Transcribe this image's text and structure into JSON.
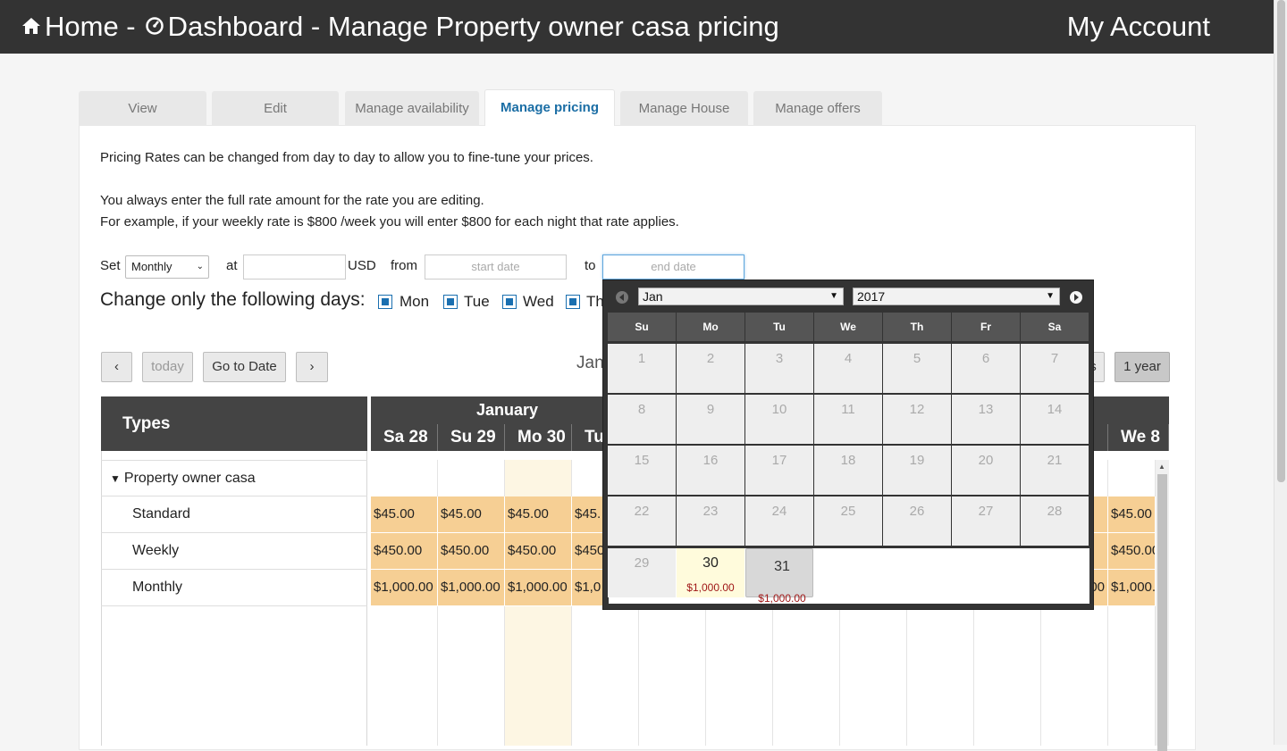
{
  "header": {
    "home_label": "Home -",
    "title": "Dashboard - Manage Property owner casa pricing",
    "account": "My Account"
  },
  "tabs": [
    "View",
    "Edit",
    "Manage availability",
    "Manage pricing",
    "Manage House",
    "Manage offers"
  ],
  "active_tab": "Manage pricing",
  "intro": {
    "line1": "Pricing Rates can be changed from day to day to allow you to fine-tune your prices.",
    "line2": "You always enter the full rate amount for the rate you are editing.",
    "line3": "For example, if your weekly rate is $800 /week you will enter $800 for each night that rate applies."
  },
  "form": {
    "set_label": "Set",
    "rate_type": "Monthly",
    "at_label": "at",
    "amount_value": "",
    "currency": "USD",
    "from_label": "from",
    "start_placeholder": "start date",
    "to_label": "to",
    "end_placeholder": "end date",
    "days_heading": "Change only the following days:",
    "days": [
      "Mon",
      "Tue",
      "Wed",
      "Th"
    ]
  },
  "nav": {
    "prev": "‹",
    "today": "today",
    "goto": "Go to Date",
    "next": "›",
    "range_title_partial": "Jan",
    "view_partial": "s",
    "view_year": "1 year"
  },
  "scheduler": {
    "types_heading": "Types",
    "month": "January",
    "days": [
      "Sa 28",
      "Su 29",
      "Mo 30",
      "Tu",
      "",
      "",
      "",
      "",
      "",
      "",
      "",
      "We 8"
    ],
    "group": "Property owner casa",
    "rows": [
      {
        "name": "Standard",
        "rate": "$45.00",
        "last": "$45.00"
      },
      {
        "name": "Weekly",
        "rate": "$450.00",
        "last": "$450.00"
      },
      {
        "name": "Monthly",
        "rate": "$1,000.00",
        "last": "$1,000."
      }
    ],
    "partial_cells": [
      "$45.",
      "$450",
      "$1,0"
    ],
    "right_partial": "00",
    "today_color": "#fdf6e3",
    "rate_color": "#f6cf94"
  },
  "datepicker": {
    "month": "Jan",
    "year": "2017",
    "weekdays": [
      "Su",
      "Mo",
      "Tu",
      "We",
      "Th",
      "Fr",
      "Sa"
    ],
    "weeks": [
      [
        "1",
        "2",
        "3",
        "4",
        "5",
        "6",
        "7"
      ],
      [
        "8",
        "9",
        "10",
        "11",
        "12",
        "13",
        "14"
      ],
      [
        "15",
        "16",
        "17",
        "18",
        "19",
        "20",
        "21"
      ],
      [
        "22",
        "23",
        "24",
        "25",
        "26",
        "27",
        "28"
      ]
    ],
    "last_week": [
      {
        "day": "29",
        "price": ""
      },
      {
        "day": "30",
        "price": "$1,000.00"
      },
      {
        "day": "31",
        "price": "$1,000.00"
      }
    ]
  }
}
